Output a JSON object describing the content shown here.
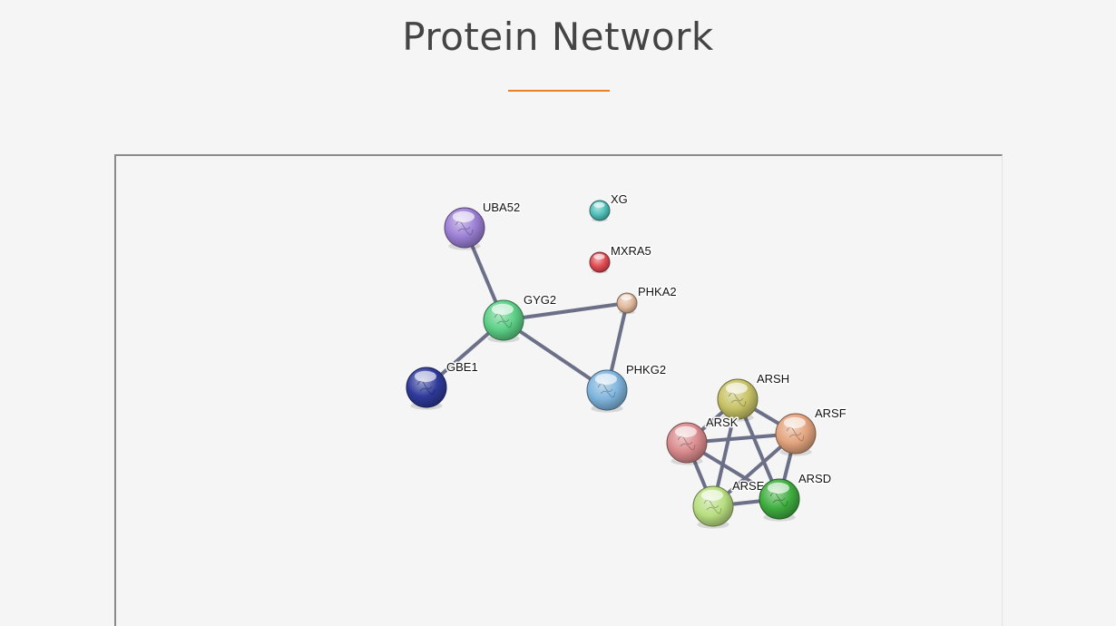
{
  "header": {
    "title": "Protein Network"
  },
  "network": {
    "nodes": [
      {
        "id": "UBA52",
        "label": "UBA52",
        "color": "#9b7fd4"
      },
      {
        "id": "XG",
        "label": "XG",
        "color": "#4fbfb8"
      },
      {
        "id": "MXRA5",
        "label": "MXRA5",
        "color": "#e04a52"
      },
      {
        "id": "GYG2",
        "label": "GYG2",
        "color": "#5ccf86"
      },
      {
        "id": "PHKA2",
        "label": "PHKA2",
        "color": "#e0b89a"
      },
      {
        "id": "GBE1",
        "label": "GBE1",
        "color": "#2e3a9a"
      },
      {
        "id": "PHKG2",
        "label": "PHKG2",
        "color": "#7fb4dc"
      },
      {
        "id": "ARSH",
        "label": "ARSH",
        "color": "#c7c266"
      },
      {
        "id": "ARSF",
        "label": "ARSF",
        "color": "#e3a47e"
      },
      {
        "id": "ARSK",
        "label": "ARSK",
        "color": "#d98a8c"
      },
      {
        "id": "ARSE",
        "label": "ARSE",
        "color": "#b8de80"
      },
      {
        "id": "ARSD",
        "label": "ARSD",
        "color": "#3fae3f"
      }
    ],
    "edges": [
      [
        "UBA52",
        "GYG2"
      ],
      [
        "GYG2",
        "GBE1"
      ],
      [
        "GYG2",
        "PHKA2"
      ],
      [
        "GYG2",
        "PHKG2"
      ],
      [
        "PHKA2",
        "PHKG2"
      ],
      [
        "ARSH",
        "ARSF"
      ],
      [
        "ARSH",
        "ARSK"
      ],
      [
        "ARSH",
        "ARSE"
      ],
      [
        "ARSH",
        "ARSD"
      ],
      [
        "ARSF",
        "ARSK"
      ],
      [
        "ARSF",
        "ARSE"
      ],
      [
        "ARSF",
        "ARSD"
      ],
      [
        "ARSK",
        "ARSE"
      ],
      [
        "ARSK",
        "ARSD"
      ],
      [
        "ARSE",
        "ARSD"
      ]
    ]
  }
}
